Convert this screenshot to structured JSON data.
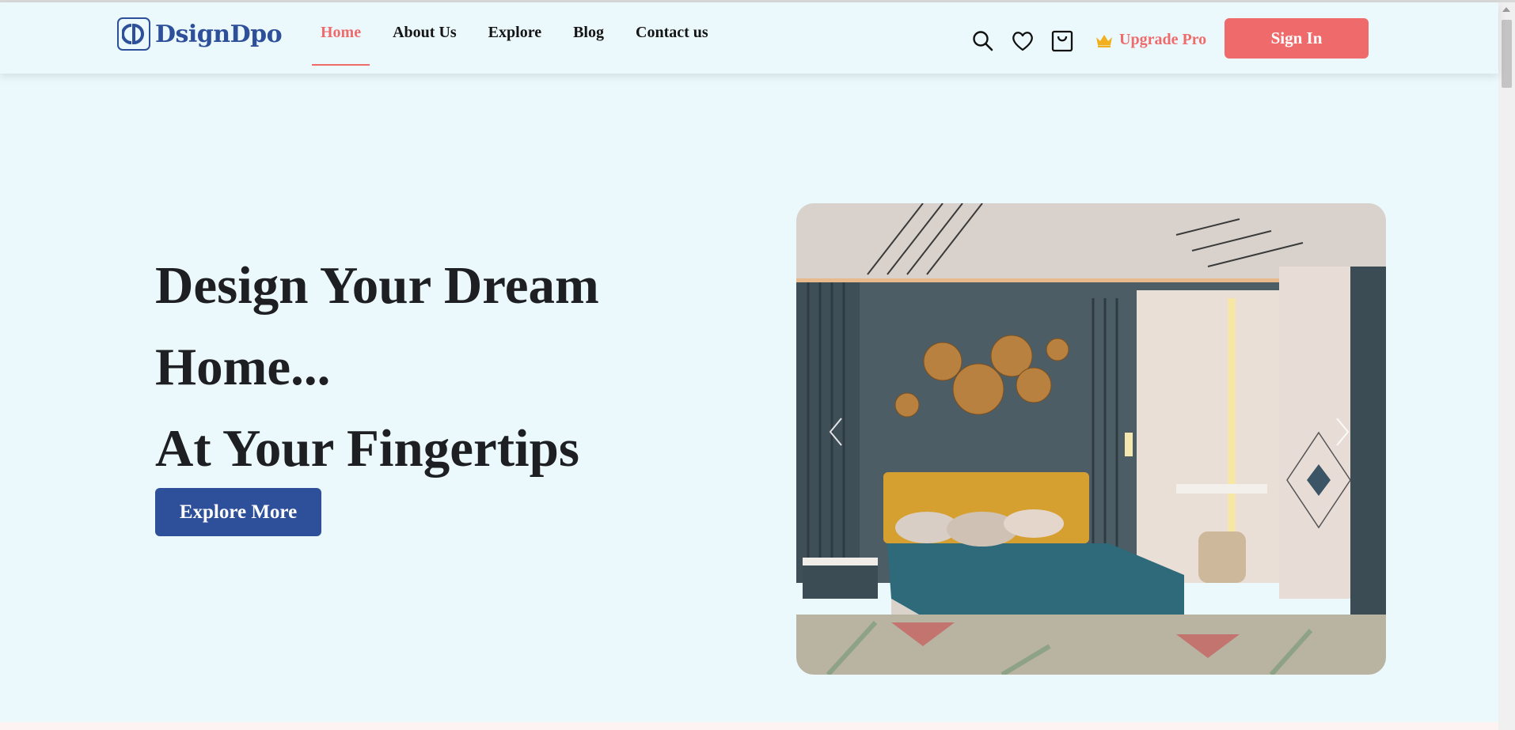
{
  "brand": {
    "name": "DsignDpo",
    "logo_glyph": "D-monogram",
    "color": "#2e4f99"
  },
  "nav": {
    "items": [
      {
        "label": "Home",
        "active": true
      },
      {
        "label": "About Us",
        "active": false
      },
      {
        "label": "Explore",
        "active": false
      },
      {
        "label": "Blog",
        "active": false
      },
      {
        "label": "Contact us",
        "active": false
      }
    ]
  },
  "header_icons": [
    "search-icon",
    "heart-icon",
    "bag-icon"
  ],
  "upgrade": {
    "label": "Upgrade Pro",
    "icon": "crown-icon",
    "icon_color": "#f2b01e"
  },
  "signin": {
    "label": "Sign In"
  },
  "hero": {
    "title_lines": [
      "Design Your Dream",
      "Home...",
      "At Your Fingertips"
    ],
    "cta_label": "Explore More"
  },
  "carousel": {
    "prev_icon": "chevron-left-icon",
    "next_icon": "chevron-right-icon"
  },
  "colors": {
    "accent": "#ef6b6b",
    "primary": "#2e4f99",
    "background": "#ebf9fc",
    "text": "#1e1f22"
  }
}
